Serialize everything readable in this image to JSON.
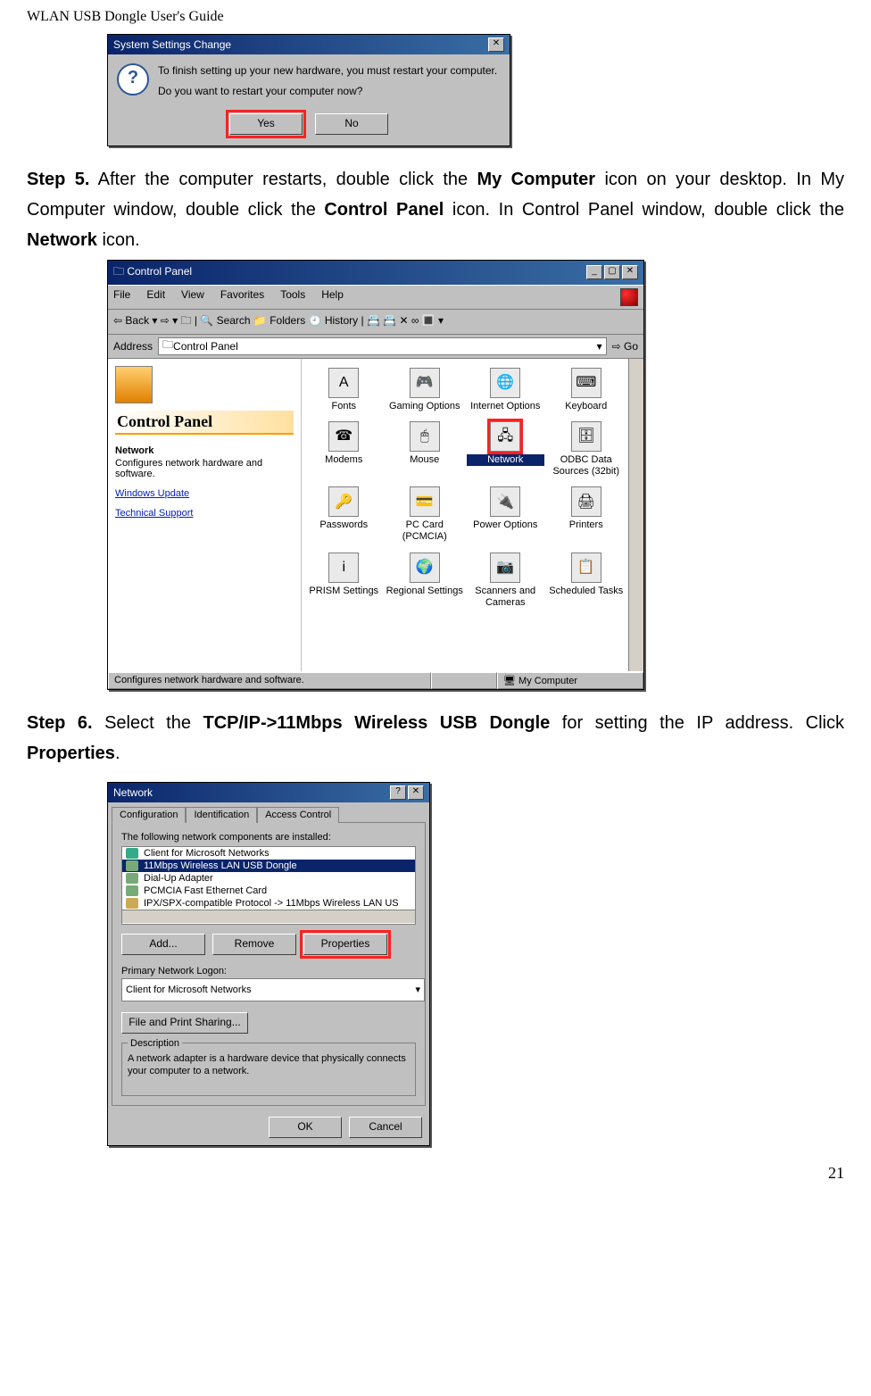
{
  "page": {
    "header": "WLAN USB Dongle User's Guide",
    "number": "21"
  },
  "dlg1": {
    "title": "System Settings Change",
    "line1": "To finish setting up your new hardware, you must restart your computer.",
    "line2": "Do you want to restart your computer now?",
    "yes": "Yes",
    "no": "No"
  },
  "step5": {
    "label": "Step 5.",
    "text_parts": [
      "  After the computer restarts, double click the ",
      "My Computer",
      " icon on your desktop. In My Computer window, double click the ",
      "Control Panel",
      " icon. In Control Panel window, double click the ",
      "Network",
      " icon."
    ]
  },
  "cp": {
    "title": "Control Panel",
    "menubar": [
      "File",
      "Edit",
      "View",
      "Favorites",
      "Tools",
      "Help"
    ],
    "toolbar": "⇦ Back  ▾   ⇨  ▾   🗀   | 🔍 Search   📁 Folders   🕘 History   |  📇  📇  ✕  ∞   🔳 ▾",
    "address_label": "Address",
    "address_value": "Control Panel",
    "go": "Go",
    "left": {
      "title": "Control Panel",
      "sub": "Network",
      "desc": "Configures network hardware and software.",
      "link1": "Windows Update",
      "link2": "Technical Support"
    },
    "icons": [
      {
        "label": "Fonts",
        "glyph": "A"
      },
      {
        "label": "Gaming Options",
        "glyph": "🎮"
      },
      {
        "label": "Internet Options",
        "glyph": "🌐"
      },
      {
        "label": "Keyboard",
        "glyph": "⌨"
      },
      {
        "label": "Modems",
        "glyph": "☎"
      },
      {
        "label": "Mouse",
        "glyph": "🖱"
      },
      {
        "label": "Network",
        "glyph": "🖧"
      },
      {
        "label": "ODBC Data Sources (32bit)",
        "glyph": "🗄"
      },
      {
        "label": "Passwords",
        "glyph": "🔑"
      },
      {
        "label": "PC Card (PCMCIA)",
        "glyph": "💳"
      },
      {
        "label": "Power Options",
        "glyph": "🔌"
      },
      {
        "label": "Printers",
        "glyph": "🖨"
      },
      {
        "label": "PRISM Settings",
        "glyph": "i"
      },
      {
        "label": "Regional Settings",
        "glyph": "🌍"
      },
      {
        "label": "Scanners and Cameras",
        "glyph": "📷"
      },
      {
        "label": "Scheduled Tasks",
        "glyph": "📋"
      }
    ],
    "status_left": "Configures network hardware and software.",
    "status_right": "My Computer"
  },
  "step6": {
    "label": "Step 6.",
    "text_parts": [
      "   Select the ",
      "TCP/IP->11Mbps Wireless USB Dongle",
      " for setting the IP address. Click ",
      "Properties",
      "."
    ]
  },
  "net": {
    "title": "Network",
    "tabs": [
      "Configuration",
      "Identification",
      "Access Control"
    ],
    "list_label": "The following network components are installed:",
    "items": [
      "Client for Microsoft Networks",
      "11Mbps Wireless LAN USB Dongle",
      "Dial-Up Adapter",
      "PCMCIA Fast Ethernet Card",
      "IPX/SPX-compatible Protocol -> 11Mbps Wireless LAN US"
    ],
    "btn_add": "Add...",
    "btn_remove": "Remove",
    "btn_props": "Properties",
    "logon_label": "Primary Network Logon:",
    "logon_value": "Client for Microsoft Networks",
    "btn_share": "File and Print Sharing...",
    "desc_legend": "Description",
    "desc_text": "A network adapter is a hardware device that physically connects your computer to a network.",
    "ok": "OK",
    "cancel": "Cancel"
  }
}
